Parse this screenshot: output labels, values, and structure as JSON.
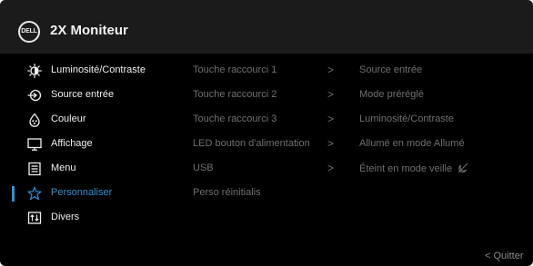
{
  "header": {
    "logo_text": "DELL",
    "title": "2X Moniteur"
  },
  "menu": {
    "items": [
      {
        "label": "Luminosité/Contraste",
        "icon": "brightness-icon"
      },
      {
        "label": "Source entrée",
        "icon": "input-source-icon"
      },
      {
        "label": "Couleur",
        "icon": "color-icon"
      },
      {
        "label": "Affichage",
        "icon": "display-icon"
      },
      {
        "label": "Menu",
        "icon": "menu-icon"
      },
      {
        "label": "Personnaliser",
        "icon": "star-icon",
        "selected": true
      },
      {
        "label": "Divers",
        "icon": "others-icon"
      }
    ]
  },
  "submenu": {
    "items": [
      {
        "label": "Touche raccourci 1",
        "arrow": ">",
        "value": "Source entrée"
      },
      {
        "label": "Touche raccourci 2",
        "arrow": ">",
        "value": "Mode préréglé"
      },
      {
        "label": "Touche raccourci 3",
        "arrow": ">",
        "value": "Luminosité/Contraste"
      },
      {
        "label": "LED bouton d'alimentation",
        "arrow": ">",
        "value": "Allumé en mode Allumé"
      },
      {
        "label": "USB",
        "arrow": ">",
        "value": "Éteint en mode veille"
      },
      {
        "label": "Perso réinitialis"
      }
    ]
  },
  "footer": {
    "quit_label": "< Quitter"
  },
  "colors": {
    "accent": "#2e8fd6",
    "background": "#000000",
    "header": "#1b1b1b",
    "text": "#f0f0f0",
    "dim_text": "#707070"
  }
}
